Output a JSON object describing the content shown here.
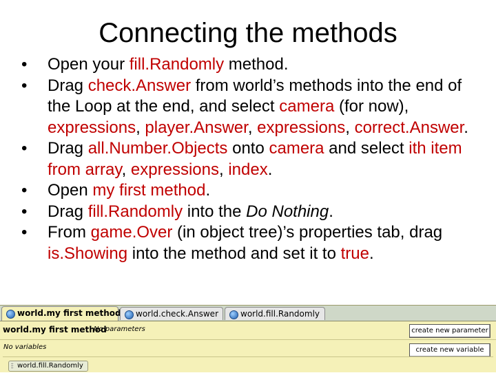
{
  "slide": {
    "title": "Connecting the methods",
    "bullets": [
      {
        "p1": "Open your ",
        "h1": "fill.Randomly",
        "p2": " method."
      },
      {
        "p1": "Drag ",
        "h1": "check.Answer",
        "p2": " from world’s methods into the end of the Loop at the end, and select ",
        "h2": "camera",
        "p3": " (for now), ",
        "h3": "expressions",
        "p4": ", ",
        "h4": "player.Answer",
        "p5": ", ",
        "h5": "expressions",
        "p6": ", ",
        "h6": "correct.Answer",
        "p7": "."
      },
      {
        "p1": "Drag ",
        "h1": "all.Number.Objects",
        "p2": " onto ",
        "h2": "camera",
        "p3": " and select ",
        "h3": "ith item from array",
        "p4": ", ",
        "h4": "expressions",
        "p5": ", ",
        "h5": "index",
        "p6": "."
      },
      {
        "p1": "Open ",
        "h1": "my first method",
        "p2": "."
      },
      {
        "p1": "Drag ",
        "h1": "fill.Randomly",
        "p2": " into the ",
        "i1": "Do Nothing",
        "p3": "."
      },
      {
        "p1": "From ",
        "h1": "game.Over",
        "p2": " (in object tree)’s properties tab, drag ",
        "h2": "is.Showing",
        "p3": " into the method and set it to ",
        "h3": "true",
        "p4": "."
      }
    ],
    "highlight_color": "#c00000"
  },
  "ide": {
    "tabs": [
      {
        "label": "world.my first method",
        "active": true
      },
      {
        "label": "world.check.Answer",
        "active": false
      },
      {
        "label": "world.fill.Randomly",
        "active": false
      }
    ],
    "tab_icon": "sphere-icon",
    "method_name": "world.my first method",
    "params_text": "No parameters",
    "create_param_label": "create new parameter",
    "vars_text": "No variables",
    "create_var_label": "create new variable",
    "statement": "world.fill.Randomly",
    "panel_color": "#f5f1b8"
  }
}
